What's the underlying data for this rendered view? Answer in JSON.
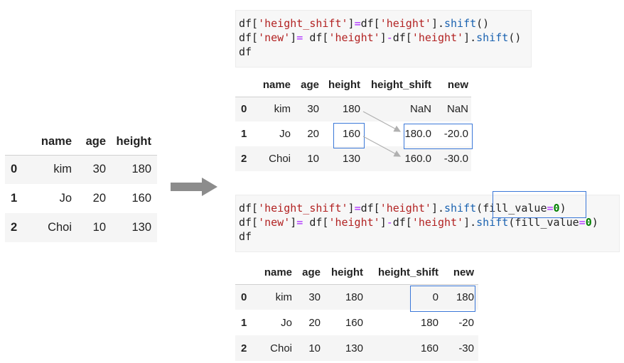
{
  "left_table": {
    "columns": [
      "name",
      "age",
      "height"
    ],
    "rows": [
      {
        "index": "0",
        "name": "kim",
        "age": "30",
        "height": "180"
      },
      {
        "index": "1",
        "name": "Jo",
        "age": "20",
        "height": "160"
      },
      {
        "index": "2",
        "name": "Choi",
        "age": "10",
        "height": "130"
      }
    ]
  },
  "code_cell_1": {
    "line1": {
      "a": "df[",
      "b": "'height_shift'",
      "c": "]",
      "d": "=",
      "e": "df[",
      "f": "'height'",
      "g": "].",
      "h": "shift",
      "i": "()"
    },
    "line2": {
      "a": "df[",
      "b": "'new'",
      "c": "]",
      "d": "=",
      "e": " df[",
      "f": "'height'",
      "g": "]",
      "h": "-",
      "i": "df[",
      "j": "'height'",
      "k": "].",
      "l": "shift",
      "m": "()"
    },
    "line3": "df"
  },
  "table_top": {
    "columns": [
      "name",
      "age",
      "height",
      "height_shift",
      "new"
    ],
    "rows": [
      {
        "index": "0",
        "name": "kim",
        "age": "30",
        "height": "180",
        "height_shift": "NaN",
        "new": "NaN"
      },
      {
        "index": "1",
        "name": "Jo",
        "age": "20",
        "height": "160",
        "height_shift": "180.0",
        "new": "-20.0"
      },
      {
        "index": "2",
        "name": "Choi",
        "age": "10",
        "height": "130",
        "height_shift": "160.0",
        "new": "-30.0"
      }
    ]
  },
  "code_cell_2": {
    "line1": {
      "a": "df[",
      "b": "'height_shift'",
      "c": "]",
      "d": "=",
      "e": "df[",
      "f": "'height'",
      "g": "].",
      "h": "shift",
      "i": "(",
      "j": "fill_value",
      "k": "=",
      "l": "0",
      "m": ")"
    },
    "line2": {
      "a": "df[",
      "b": "'new'",
      "c": "]",
      "d": "=",
      "e": " df[",
      "f": "'height'",
      "g": "]",
      "h": "-",
      "i": "df[",
      "j": "'height'",
      "k": "].",
      "l": "shift",
      "m": "(",
      "n": "fill_value",
      "o": "=",
      "p": "0",
      "q": ")"
    },
    "line3": "df"
  },
  "table_bottom": {
    "columns": [
      "name",
      "age",
      "height",
      "height_shift",
      "new"
    ],
    "rows": [
      {
        "index": "0",
        "name": "kim",
        "age": "30",
        "height": "180",
        "height_shift": "0",
        "new": "180"
      },
      {
        "index": "1",
        "name": "Jo",
        "age": "20",
        "height": "160",
        "height_shift": "180",
        "new": "-20"
      },
      {
        "index": "2",
        "name": "Choi",
        "age": "10",
        "height": "130",
        "height_shift": "160",
        "new": "-30"
      }
    ]
  },
  "colors": {
    "highlight": "#3b78d8",
    "arrow": "#8c8c8c",
    "pointer": "#b0b0b0",
    "string": "#b22222",
    "function": "#1a62b0",
    "number": "#008000"
  },
  "icons": {
    "transform_arrow": "right-arrow-icon"
  }
}
